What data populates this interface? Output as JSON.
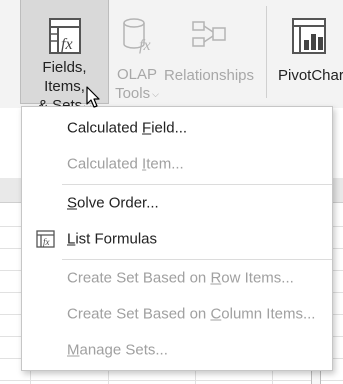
{
  "ribbon": {
    "fields_items_sets": {
      "line1": "Fields, Items,",
      "line2": "& Sets",
      "icon": "fx-table-icon"
    },
    "olap_tools": {
      "line1": "OLAP",
      "line2": "Tools",
      "icon": "cylinder-fx-icon"
    },
    "relationships": {
      "line1": "Relationships",
      "icon": "relationships-icon"
    },
    "pivotchart": {
      "line1": "PivotChart",
      "icon": "pivotchart-icon"
    }
  },
  "menu": {
    "calculated_field": {
      "pre": "Calculated ",
      "ul": "F",
      "post": "ield..."
    },
    "calculated_item": {
      "pre": "Calculated ",
      "ul": "I",
      "post": "tem..."
    },
    "solve_order": {
      "pre": "",
      "ul": "S",
      "post": "olve Order..."
    },
    "list_formulas": {
      "pre": "",
      "ul": "L",
      "post": "ist Formulas"
    },
    "create_set_row": {
      "pre": "Create Set Based on ",
      "ul": "R",
      "post": "ow Items..."
    },
    "create_set_col": {
      "pre": "Create Set Based on ",
      "ul": "C",
      "post": "olumn Items..."
    },
    "manage_sets": {
      "pre": "",
      "ul": "M",
      "post": "anage Sets..."
    }
  },
  "colors": {
    "ribbon_bg": "#f3f3f3",
    "pressed_bg": "#d9d9d9",
    "disabled_text": "#a0a0a0"
  }
}
